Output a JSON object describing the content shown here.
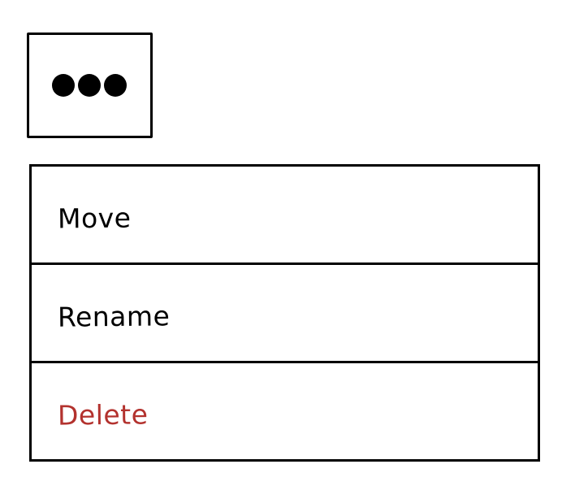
{
  "trigger": {
    "icon": "more-horizontal-icon"
  },
  "menu": {
    "items": [
      {
        "label": "Move"
      },
      {
        "label": "Rename"
      },
      {
        "label": "Delete"
      }
    ]
  },
  "colors": {
    "text": "#000000",
    "danger": "#b3322e",
    "border": "#000000",
    "background": "#ffffff"
  }
}
